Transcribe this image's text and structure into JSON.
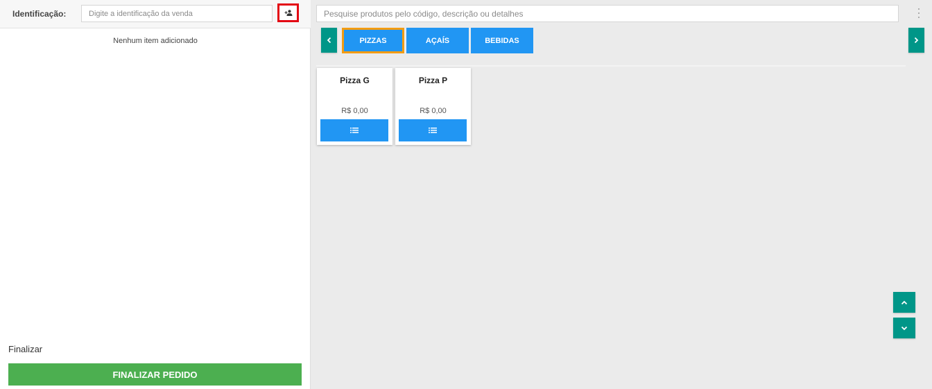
{
  "identification": {
    "label": "Identificação:",
    "placeholder": "Digite a identificação da venda",
    "value": ""
  },
  "cart": {
    "empty_message": "Nenhum item adicionado"
  },
  "finalize": {
    "section_label": "Finalizar",
    "button_label": "FINALIZAR PEDIDO"
  },
  "search": {
    "placeholder": "Pesquise produtos pelo código, descrição ou detalhes",
    "value": ""
  },
  "categories": [
    {
      "label": "PIZZAS",
      "selected": true
    },
    {
      "label": "AÇAÍS",
      "selected": false
    },
    {
      "label": "BEBIDAS",
      "selected": false
    }
  ],
  "products": [
    {
      "name": "Pizza G",
      "price": "R$ 0,00"
    },
    {
      "name": "Pizza P",
      "price": "R$ 0,00"
    }
  ],
  "icons": {
    "client": "add-client-icon",
    "prev": "chevron-left-icon",
    "next": "chevron-right-icon",
    "menu": "kebab-menu-icon",
    "list": "list-icon",
    "up": "chevron-up-icon",
    "down": "chevron-down-icon"
  },
  "colors": {
    "primary": "#2196f3",
    "accent": "#009688",
    "success": "#4caf50",
    "selected_border": "#f39c12",
    "highlight": "#e30613"
  }
}
